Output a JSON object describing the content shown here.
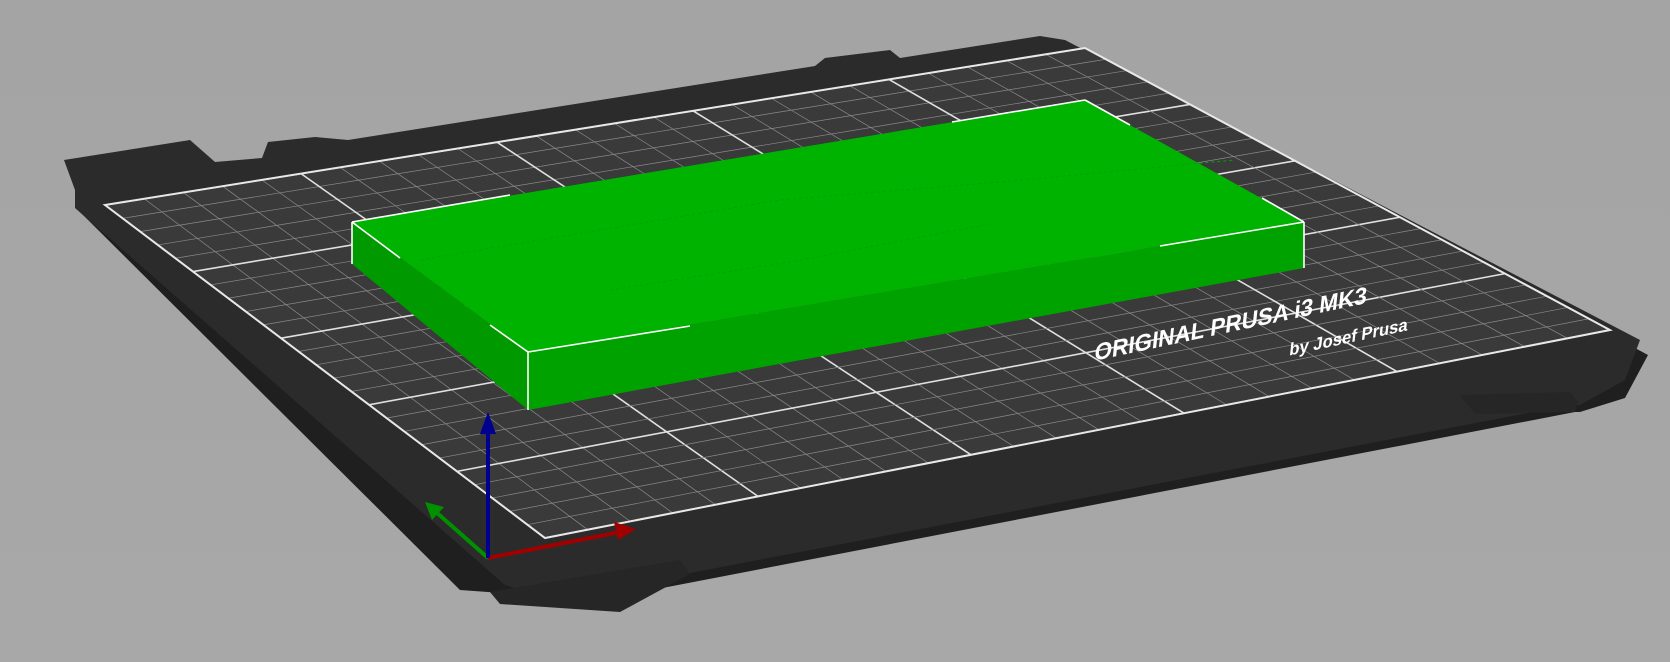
{
  "viewport": {
    "background_color": "#a6a6a6"
  },
  "bed": {
    "label_model": "ORIGINAL PRUSA i3 MK3",
    "label_maker": "by Josef Prusa",
    "plate_color": "#2b2b2b",
    "surface_color": "#3a3a3a",
    "grid_color": "#ffffff"
  },
  "model": {
    "color": "#00b300",
    "state": "selected"
  },
  "axes": {
    "x_color": "#a00000",
    "y_color": "#009000",
    "z_color": "#000090"
  }
}
